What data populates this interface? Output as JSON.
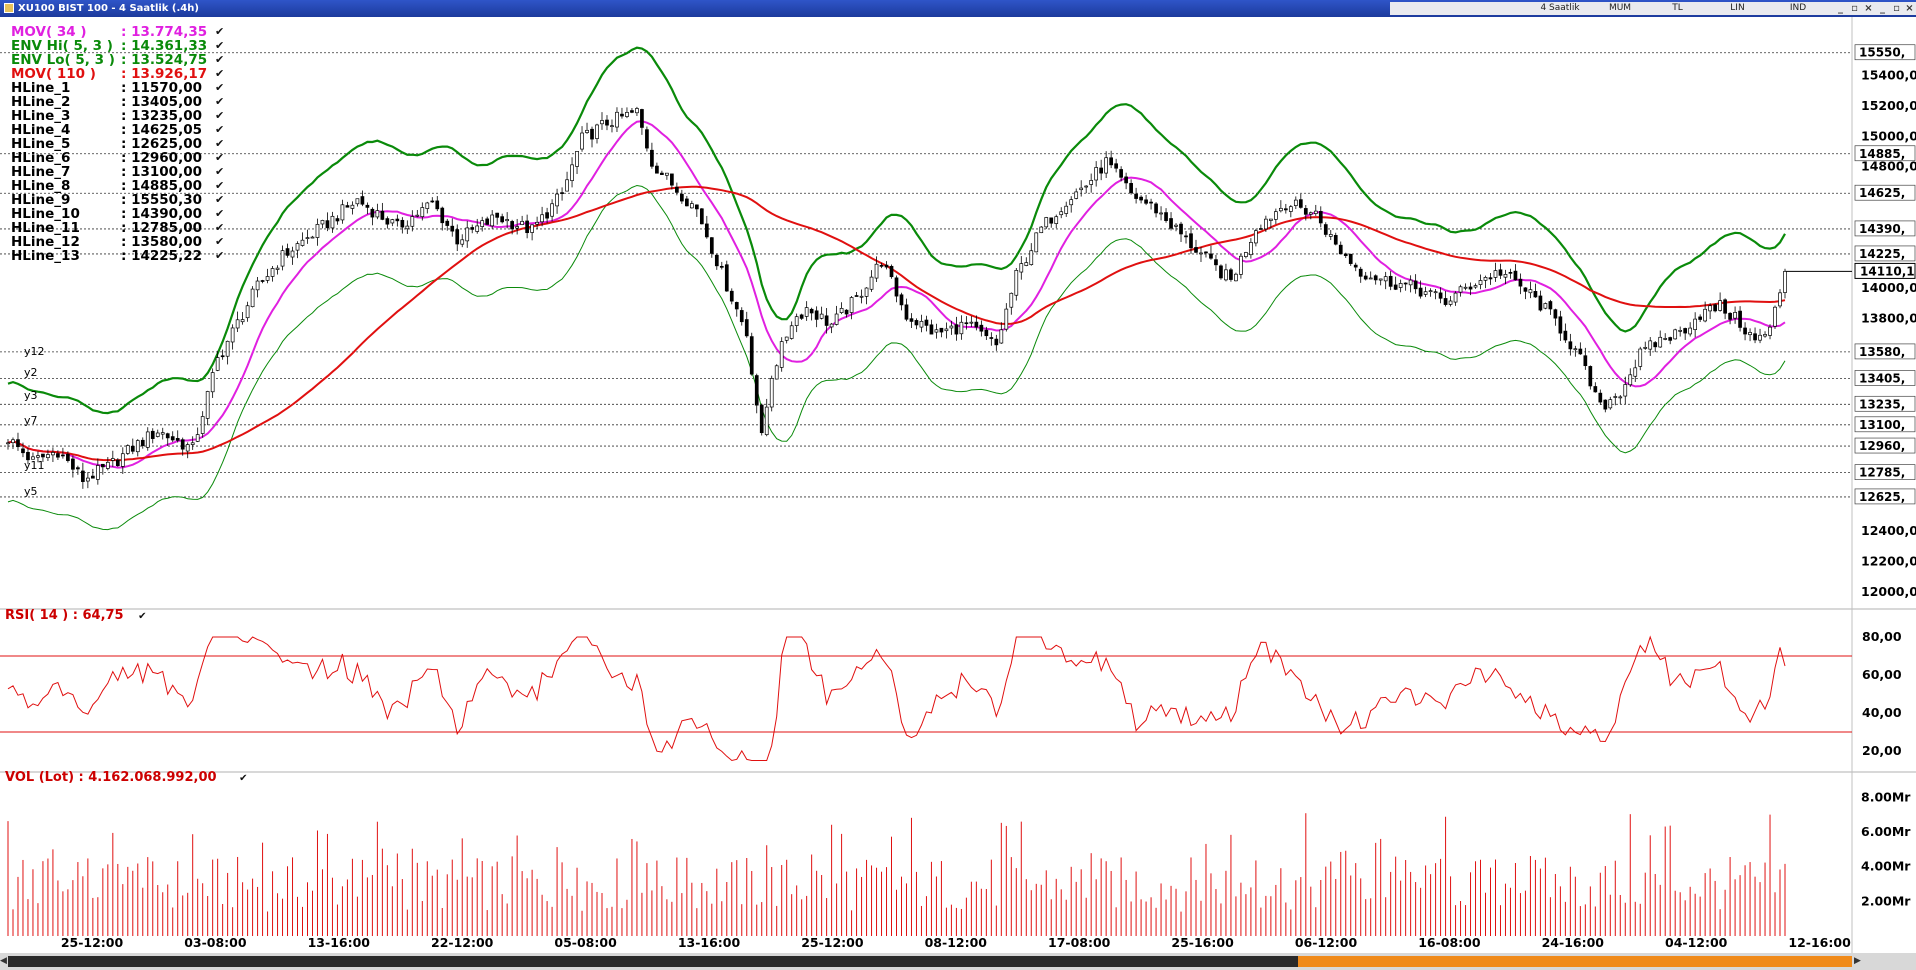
{
  "window": {
    "title": "XU100 BIST 100 - 4 Saatlik (.4h)",
    "toolbar": [
      "4 Saatlik",
      "MUM",
      "TL",
      "LIN",
      "IND"
    ],
    "controls": [
      "_",
      "▫",
      "×",
      "_",
      "▫",
      "×"
    ]
  },
  "main_legend": [
    {
      "label": "MOV( 34 )",
      "value": ": 13.774,35",
      "color": "#e020e0"
    },
    {
      "label": "ENV Hi( 5, 3 )",
      "value": ": 14.361,33",
      "color": "#0a8a0a"
    },
    {
      "label": "ENV Lo( 5, 3 )",
      "value": ": 13.524,75",
      "color": "#0a8a0a"
    },
    {
      "label": "MOV( 110 )",
      "value": ": 13.926,17",
      "color": "#e01010"
    },
    {
      "label": "HLine_1",
      "value": ": 11570,00",
      "color": "#000000"
    },
    {
      "label": "HLine_2",
      "value": ": 13405,00",
      "color": "#000000"
    },
    {
      "label": "HLine_3",
      "value": ": 13235,00",
      "color": "#000000"
    },
    {
      "label": "HLine_4",
      "value": ": 14625,05",
      "color": "#000000"
    },
    {
      "label": "HLine_5",
      "value": ": 12625,00",
      "color": "#000000"
    },
    {
      "label": "HLine_6",
      "value": ": 12960,00",
      "color": "#000000"
    },
    {
      "label": "HLine_7",
      "value": ": 13100,00",
      "color": "#000000"
    },
    {
      "label": "HLine_8",
      "value": ": 14885,00",
      "color": "#000000"
    },
    {
      "label": "HLine_9",
      "value": ": 15550,30",
      "color": "#000000"
    },
    {
      "label": "HLine_10",
      "value": ": 14390,00",
      "color": "#000000"
    },
    {
      "label": "HLine_11",
      "value": ": 12785,00",
      "color": "#000000"
    },
    {
      "label": "HLine_12",
      "value": ": 13580,00",
      "color": "#000000"
    },
    {
      "label": "HLine_13",
      "value": ": 14225,22",
      "color": "#000000"
    }
  ],
  "line_tags": [
    "y12",
    "y2",
    "y3",
    "y7",
    "y11",
    "y5"
  ],
  "rsi_label": "RSI( 14 ) : 64,75",
  "vol_label": "VOL (Lot) : 4.162.068.992,00",
  "chart_data": [
    {
      "type": "candlestick",
      "ylim": [
        11900,
        15700
      ],
      "yticks": [
        "15400,00",
        "15200,00",
        "15000,00",
        "14800,00",
        "14000,00",
        "13800,00",
        "12400,00",
        "12200,00",
        "12000,00"
      ],
      "ytick_values": [
        15400,
        15200,
        15000,
        14800,
        14000,
        13800,
        12400,
        12200,
        12000
      ],
      "hlines": [
        {
          "value": 15550.3,
          "label": "15550,"
        },
        {
          "value": 14885,
          "label": "14885,"
        },
        {
          "value": 14625.05,
          "label": "14625,"
        },
        {
          "value": 14390,
          "label": "14390,"
        },
        {
          "value": 14225.22,
          "label": "14225,"
        },
        {
          "value": 13580,
          "label": "13580,"
        },
        {
          "value": 13405,
          "label": "13405,"
        },
        {
          "value": 13235,
          "label": "13235,"
        },
        {
          "value": 13100,
          "label": "13100,"
        },
        {
          "value": 12960,
          "label": "12960,"
        },
        {
          "value": 12785,
          "label": "12785,"
        },
        {
          "value": 12625,
          "label": "12625,"
        }
      ],
      "last_price": {
        "value": 14110.1,
        "label": "14110,1"
      },
      "xticks": [
        "25-12:00",
        "03-08:00",
        "13-16:00",
        "22-12:00",
        "05-08:00",
        "13-16:00",
        "25-12:00",
        "08-12:00",
        "17-08:00",
        "25-16:00",
        "06-12:00",
        "16-08:00",
        "24-16:00",
        "04-12:00",
        "12-16:00"
      ],
      "close_anchors": [
        [
          0,
          13010
        ],
        [
          5,
          12860
        ],
        [
          10,
          12930
        ],
        [
          15,
          12740
        ],
        [
          20,
          12820
        ],
        [
          25,
          12950
        ],
        [
          30,
          13060
        ],
        [
          37,
          12940
        ],
        [
          42,
          13530
        ],
        [
          50,
          14010
        ],
        [
          55,
          14210
        ],
        [
          62,
          14380
        ],
        [
          70,
          14580
        ],
        [
          78,
          14400
        ],
        [
          85,
          14560
        ],
        [
          90,
          14320
        ],
        [
          98,
          14470
        ],
        [
          105,
          14380
        ],
        [
          111,
          14620
        ],
        [
          115,
          14980
        ],
        [
          120,
          15090
        ],
        [
          126,
          15160
        ],
        [
          129,
          14830
        ],
        [
          134,
          14650
        ],
        [
          138,
          14520
        ],
        [
          143,
          14100
        ],
        [
          148,
          13700
        ],
        [
          151,
          13010
        ],
        [
          153,
          13430
        ],
        [
          157,
          13780
        ],
        [
          160,
          13870
        ],
        [
          165,
          13760
        ],
        [
          170,
          13930
        ],
        [
          175,
          14180
        ],
        [
          180,
          13820
        ],
        [
          186,
          13700
        ],
        [
          192,
          13760
        ],
        [
          198,
          13620
        ],
        [
          202,
          14080
        ],
        [
          207,
          14390
        ],
        [
          212,
          14580
        ],
        [
          216,
          14680
        ],
        [
          220,
          14830
        ],
        [
          225,
          14620
        ],
        [
          230,
          14520
        ],
        [
          236,
          14320
        ],
        [
          241,
          14160
        ],
        [
          245,
          14050
        ],
        [
          250,
          14400
        ],
        [
          256,
          14560
        ],
        [
          262,
          14490
        ],
        [
          266,
          14280
        ],
        [
          271,
          14110
        ],
        [
          276,
          14050
        ],
        [
          282,
          14000
        ],
        [
          288,
          13910
        ],
        [
          294,
          14040
        ],
        [
          299,
          14110
        ],
        [
          305,
          13960
        ],
        [
          310,
          13790
        ],
        [
          315,
          13530
        ],
        [
          319,
          13210
        ],
        [
          323,
          13320
        ],
        [
          327,
          13560
        ],
        [
          331,
          13660
        ],
        [
          335,
          13710
        ],
        [
          339,
          13830
        ],
        [
          343,
          13880
        ],
        [
          347,
          13770
        ],
        [
          350,
          13650
        ],
        [
          353,
          13720
        ],
        [
          356,
          14110
        ]
      ],
      "series": [
        {
          "name": "MOV( 34 )",
          "color": "#e020e0",
          "last": 13774.35
        },
        {
          "name": "ENV Hi( 5, 3 )",
          "color": "#0a8a0a",
          "last": 14361.33
        },
        {
          "name": "ENV Lo( 5, 3 )",
          "color": "#0a8a0a",
          "last": 13524.75
        },
        {
          "name": "MOV( 110 )",
          "color": "#e01010",
          "last": 13926.17
        }
      ]
    },
    {
      "type": "line",
      "title": "RSI( 14 ) : 64,75",
      "ylim": [
        10,
        90
      ],
      "yticks": [
        "80,00",
        "60,00",
        "40,00",
        "20,00"
      ],
      "ytick_values": [
        80,
        60,
        40,
        20
      ],
      "levels": [
        70,
        30
      ],
      "last": 64.75
    },
    {
      "type": "bar",
      "title": "VOL (Lot) : 4.162.068.992,00",
      "ylim": [
        0,
        9000000000
      ],
      "yticks": [
        "8.00Mr",
        "6.00Mr",
        "4.00Mr",
        "2.00Mr"
      ],
      "ytick_values": [
        8000000000,
        6000000000,
        4000000000,
        2000000000
      ],
      "last": 4162068992
    }
  ]
}
